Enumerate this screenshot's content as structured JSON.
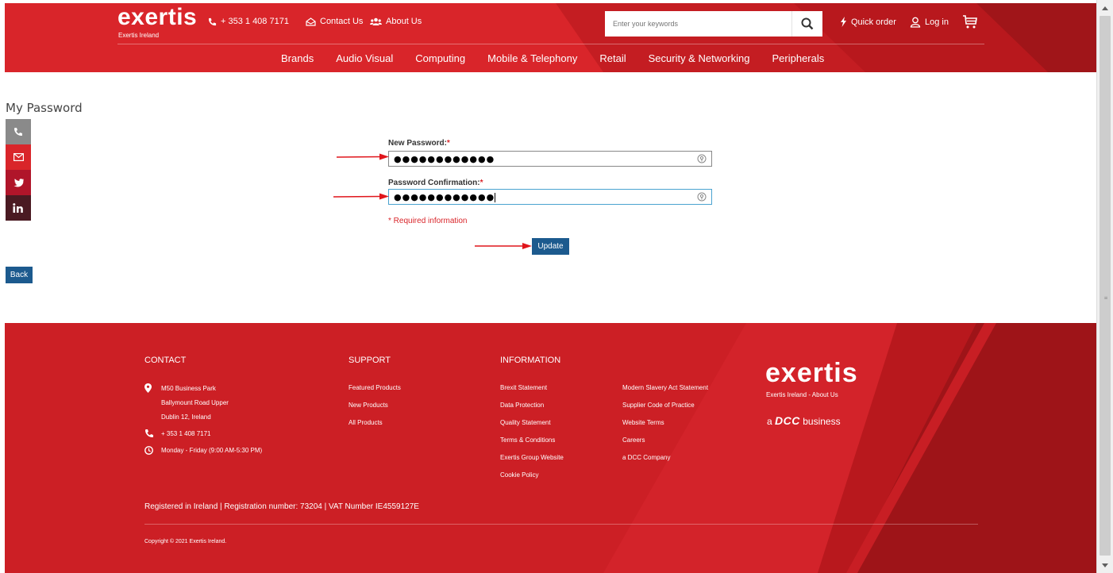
{
  "header": {
    "logo": "exertis",
    "logo_sub": "Exertis Ireland",
    "phone": "+ 353 1 408 7171",
    "contact": "Contact Us",
    "about": "About Us",
    "search_placeholder": "Enter your keywords",
    "quick_order": "Quick order",
    "login": "Log in"
  },
  "nav": [
    "Brands",
    "Audio Visual",
    "Computing",
    "Mobile & Telephony",
    "Retail",
    "Security & Networking",
    "Peripherals"
  ],
  "main": {
    "title": "My Password",
    "new_password_label": "New Password:",
    "new_password_value": "●●●●●●●●●●●●",
    "confirm_label": "Password Confirmation:",
    "confirm_value": "●●●●●●●●●●●●",
    "required_star": "*",
    "required_note": "* Required information",
    "update_label": "Update",
    "back_label": "Back"
  },
  "footer": {
    "contact_heading": "CONTACT",
    "support_heading": "SUPPORT",
    "information_heading": "INFORMATION",
    "address": [
      "M50 Business Park",
      "Ballymount Road Upper",
      "Dublin 12, Ireland"
    ],
    "phone": "+ 353 1 408 7171",
    "hours": "Monday - Friday (9:00 AM-5:30 PM)",
    "support_links": [
      "Featured Products",
      "New Products",
      "All Products"
    ],
    "info_links_1": [
      "Brexit Statement",
      "Data Protection",
      "Quality Statement",
      "Terms & Conditions",
      "Exertis Group Website",
      "Cookie Policy"
    ],
    "info_links_2": [
      "Modern Slavery Act Statement",
      "Supplier Code of Practice",
      "Website Terms",
      "Careers",
      "a DCC Company"
    ],
    "logo": "exertis",
    "logo_sub": "Exertis Ireland - About Us",
    "dcc_a": "a",
    "dcc_brand": "DCC",
    "dcc_business": "business",
    "registered": "Registered in Ireland | Registration number: 73204 | VAT Number IE4559127E",
    "copyright": "Copyright © 2021 Exertis Ireland."
  },
  "colors": {
    "brand_red": "#d9252a",
    "button_blue": "#1c5a8e",
    "annotation_arrow": "#e0161c"
  }
}
